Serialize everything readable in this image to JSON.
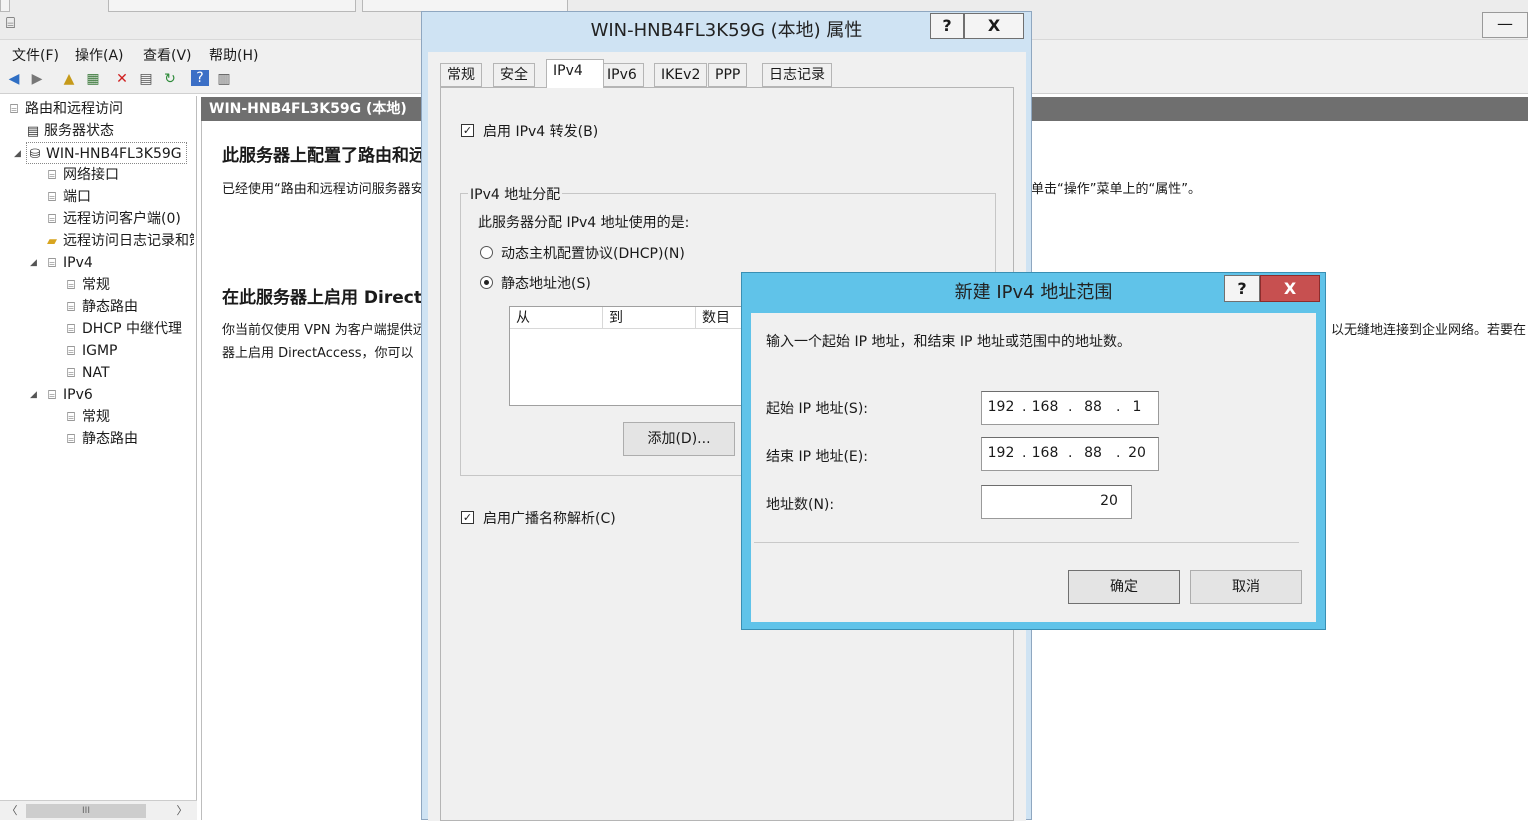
{
  "mmc": {
    "menu": [
      "文件(F)",
      "操作(A)",
      "查看(V)",
      "帮助(H)"
    ],
    "minimize": "—",
    "tree": {
      "root": "路由和远程访问",
      "server_status": "服务器状态",
      "server": "WIN-HNB4FL3K59G",
      "network_interfaces": "网络接口",
      "ports": "端口",
      "remote_clients": "远程访问客户端(0)",
      "remote_logging": "远程访问日志记录和策略",
      "ipv4": "IPv4",
      "ipv4_general": "常规",
      "ipv4_static_routes": "静态路由",
      "dhcp_relay": "DHCP 中继代理",
      "igmp": "IGMP",
      "nat": "NAT",
      "ipv6": "IPv6",
      "ipv6_general": "常规",
      "ipv6_static_routes": "静态路由",
      "scroll_thumb": "III"
    },
    "content_header": "WIN-HNB4FL3K59G (本地)",
    "section1_title": "此服务器上配置了路由和远程访问",
    "section1_text_left": "已经使用“路由和远程访问服务器安装向导”配置了此服务器。要更改此服务器的配置，请",
    "section1_text_right": "单击“操作”菜单上的“属性”。",
    "section2_title": "在此服务器上启用 DirectAccess",
    "section2_text1_left": "你当前仅使用 VPN 为客户端提供远程访问。",
    "section2_text1_right": "以无缝地连接到企业网络。若要在",
    "section2_text2_left": "器上启用 DirectAccess，你可以"
  },
  "properties": {
    "title": "WIN-HNB4FL3K59G (本地) 属性",
    "help": "?",
    "close": "X",
    "tabs": [
      "常规",
      "安全",
      "IPv4",
      "IPv6",
      "IKEv2",
      "PPP",
      "日志记录"
    ],
    "enable_forwarding": "启用 IPv4 转发(B)",
    "group_title": "IPv4 地址分配",
    "assign_prompt": "此服务器分配 IPv4 地址使用的是:",
    "dhcp_option": "动态主机配置协议(DHCP)(N)",
    "static_option": "静态地址池(S)",
    "columns": [
      "从",
      "到",
      "数目"
    ],
    "add_button": "添加(D)...",
    "broadcast": "启用广播名称解析(C)",
    "check_mark": "✓"
  },
  "new_range": {
    "title": "新建 IPv4 地址范围",
    "help": "?",
    "close": "X",
    "instruction": "输入一个起始 IP 地址，和结束 IP 地址或范围中的地址数。",
    "start_label": "起始 IP 地址(S):",
    "start_ip": [
      "192",
      "168",
      "88",
      "1"
    ],
    "end_label": "结束 IP 地址(E):",
    "end_ip": [
      "192",
      "168",
      "88",
      "20"
    ],
    "count_label": "地址数(N):",
    "count_value": "20",
    "ok": "确定",
    "cancel": "取消",
    "dot": "."
  },
  "colors": {
    "dialog_frame": "#60c3e9",
    "close_red": "#c75050",
    "content_header": "#6f6f6f"
  }
}
